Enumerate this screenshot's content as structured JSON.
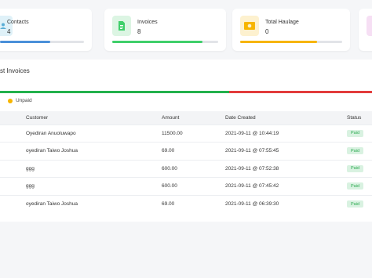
{
  "stats": [
    {
      "label": "Contacts",
      "value": "4",
      "progress": 0.6,
      "color": "#4a90d9",
      "icon": "contacts-icon",
      "icon_bg": "#dff1f8"
    },
    {
      "label": "Invoices",
      "value": "8",
      "progress": 0.85,
      "color": "#3fcf6a",
      "icon": "invoice-doc-icon",
      "icon_bg": "#dcf5e3"
    },
    {
      "label": "Total Haulage",
      "value": "0",
      "progress": 0.75,
      "color": "#f7b500",
      "icon": "cash-icon",
      "icon_bg": "#fdf1cf"
    }
  ],
  "invoices_panel": {
    "title": "st Invoices",
    "paid_share": 0.615,
    "paid_color": "#22b14c",
    "unpaid_color": "#e23b3b",
    "legend_unpaid": "Unpaid",
    "columns": {
      "customer": "Customer",
      "amount": "Amount",
      "date": "Date Created",
      "status": "Status"
    },
    "rows": [
      {
        "customer": "Oyediran Anuoluwapo",
        "amount": "11500.00",
        "date": "2021-09-11 @ 10:44:19",
        "status": "Paid"
      },
      {
        "customer": "oyediran Taiwo Joshua",
        "amount": "69.00",
        "date": "2021-09-11 @ 07:55:45",
        "status": "Paid"
      },
      {
        "customer": "ggg",
        "amount": "600.00",
        "date": "2021-09-11 @ 07:52:38",
        "status": "Paid"
      },
      {
        "customer": "ggg",
        "amount": "600.00",
        "date": "2021-09-11 @ 07:45:42",
        "status": "Paid"
      },
      {
        "customer": "oyediran Taiwo Joshua",
        "amount": "69.00",
        "date": "2021-09-11 @ 06:39:30",
        "status": "Paid"
      }
    ]
  }
}
